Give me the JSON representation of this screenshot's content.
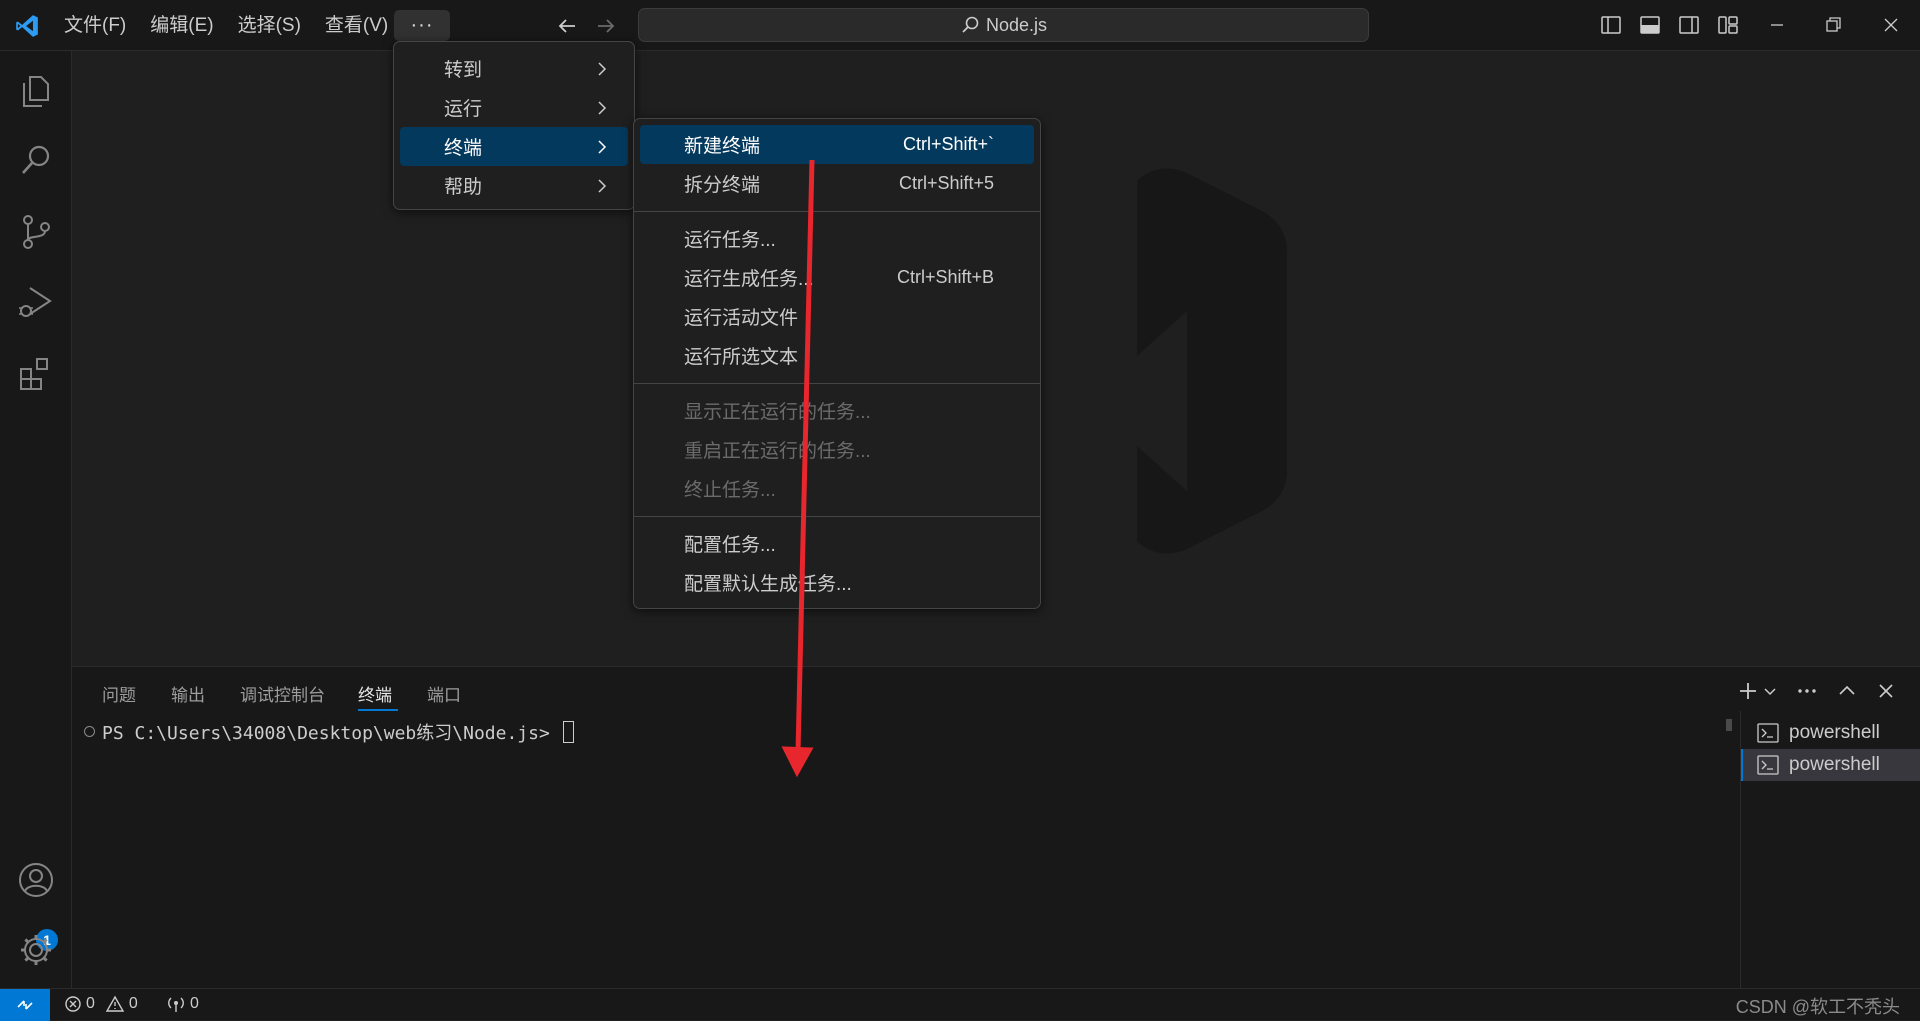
{
  "menubar": {
    "items": [
      "文件(F)",
      "编辑(E)",
      "选择(S)",
      "查看(V)"
    ],
    "more_label": "···"
  },
  "command_center": {
    "text": "Node.js"
  },
  "top_menu": {
    "items": [
      {
        "label": "转到"
      },
      {
        "label": "运行"
      },
      {
        "label": "终端"
      },
      {
        "label": "帮助"
      }
    ]
  },
  "terminal_menu": {
    "group1": [
      {
        "label": "新建终端",
        "shortcut": "Ctrl+Shift+`"
      },
      {
        "label": "拆分终端",
        "shortcut": "Ctrl+Shift+5"
      }
    ],
    "group2": [
      {
        "label": "运行任务...",
        "shortcut": ""
      },
      {
        "label": "运行生成任务...",
        "shortcut": "Ctrl+Shift+B"
      },
      {
        "label": "运行活动文件",
        "shortcut": ""
      },
      {
        "label": "运行所选文本",
        "shortcut": ""
      }
    ],
    "group3": [
      {
        "label": "显示正在运行的任务..."
      },
      {
        "label": "重启正在运行的任务..."
      },
      {
        "label": "终止任务..."
      }
    ],
    "group4": [
      {
        "label": "配置任务..."
      },
      {
        "label": "配置默认生成任务..."
      }
    ]
  },
  "panel": {
    "tabs": [
      "问题",
      "输出",
      "调试控制台",
      "终端",
      "端口"
    ],
    "active_tab": "终端",
    "prompt": "PS C:\\Users\\34008\\Desktop\\web练习\\Node.js> ",
    "terminals": [
      "powershell",
      "powershell"
    ]
  },
  "accounts_badge": "1",
  "statusbar": {
    "errors": "0",
    "warnings": "0",
    "ports": "0",
    "watermark": "CSDN @软工不秃头"
  },
  "colors": {
    "accent": "#0078d4",
    "highlight": "#04395e",
    "annotation_arrow": "#e8262d"
  }
}
